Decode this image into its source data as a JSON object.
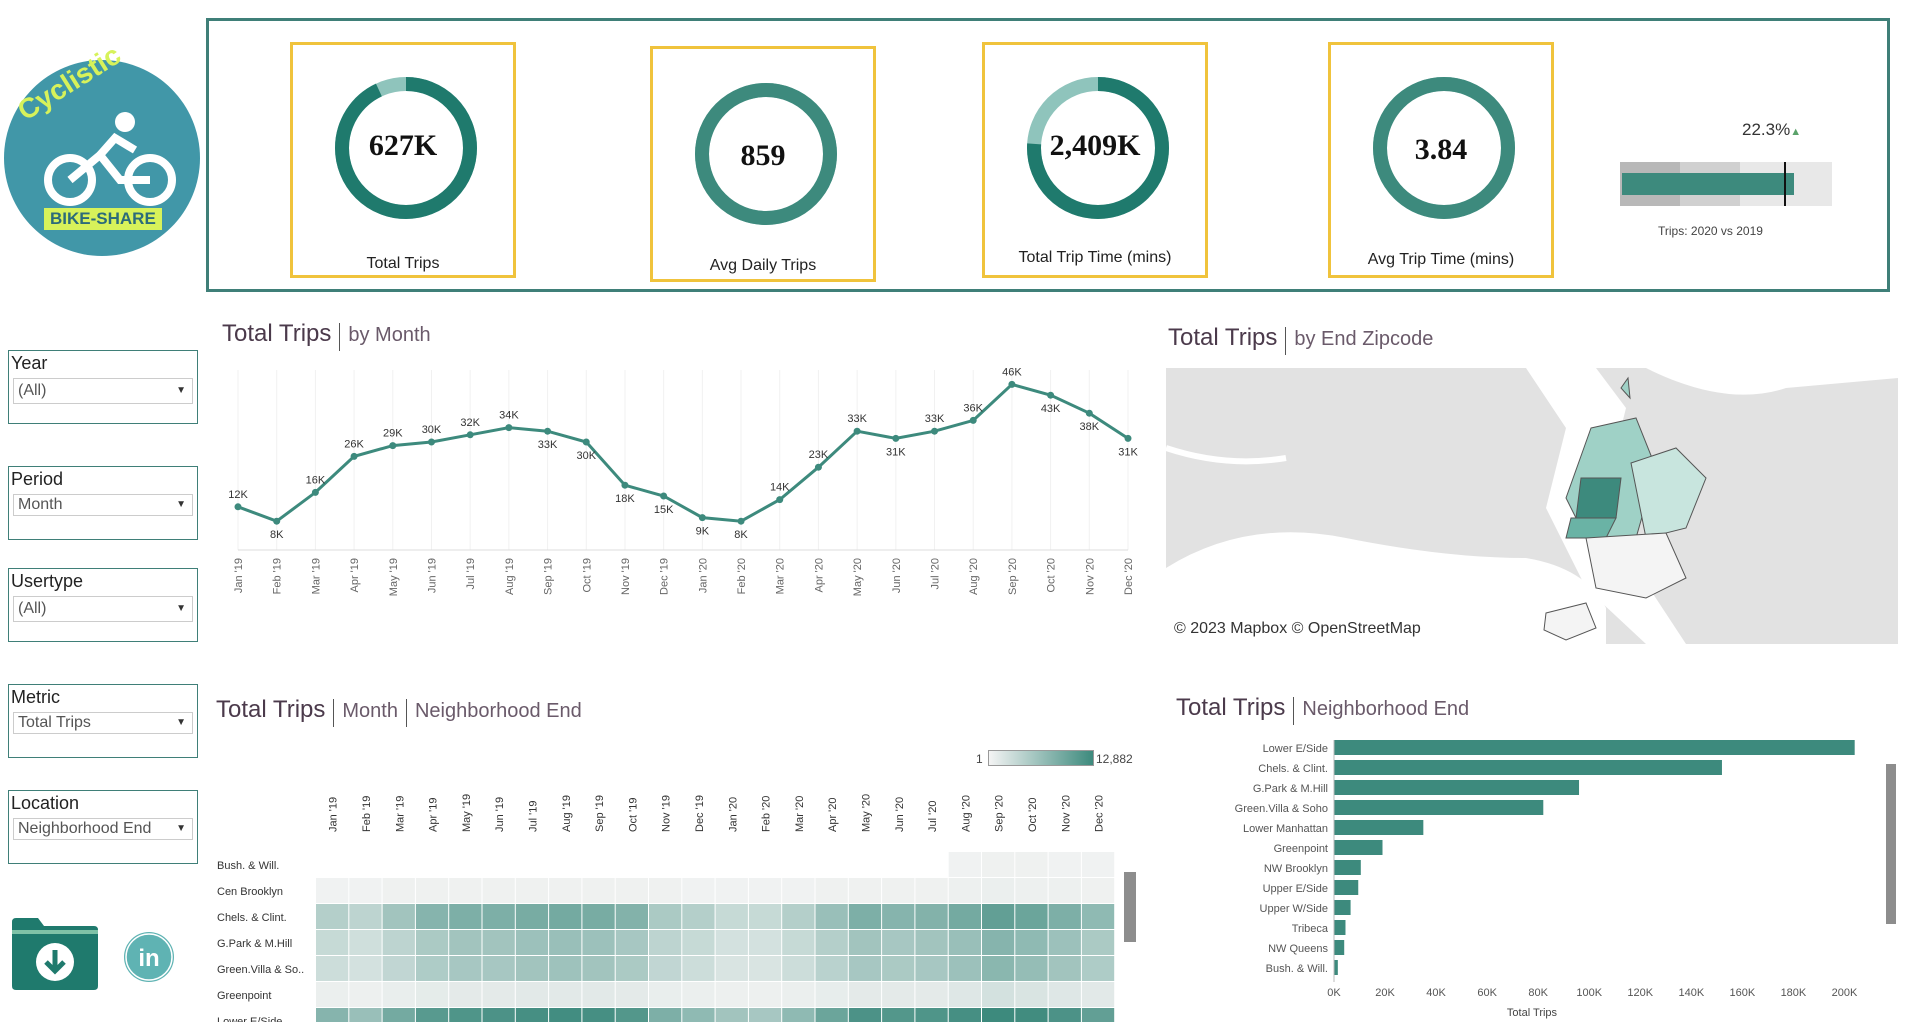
{
  "logo": {
    "word": "Cyclistic",
    "badge": "BIKE-SHARE"
  },
  "kpis": [
    {
      "value": "627K",
      "label": "Total Trips",
      "fill": 0.93
    },
    {
      "value": "859",
      "label": "Avg Daily Trips",
      "fill": 1.0
    },
    {
      "value": "2,409K",
      "label": "Total Trip  Time (mins)",
      "fill": 0.76
    },
    {
      "value": "3.84",
      "label": "Avg Trip Time (mins)",
      "fill": 1.0
    }
  ],
  "comparison": {
    "pct": "22.3%",
    "arrow": "▲",
    "label": "Trips: 2020 vs 2019",
    "fill": 0.82
  },
  "filters": [
    {
      "title": "Year",
      "value": "(All)"
    },
    {
      "title": "Period",
      "value": "Month"
    },
    {
      "title": "Usertype",
      "value": "(All)"
    },
    {
      "title": "Metric",
      "value": "Total Trips"
    },
    {
      "title": "Location",
      "value": "Neighborhood End"
    }
  ],
  "line_section": {
    "title": "Total Trips",
    "sub": "by  Month"
  },
  "map_section": {
    "title": "Total Trips",
    "sub": "by End Zipcode",
    "credit": "© 2023 Mapbox © OpenStreetMap"
  },
  "heat_section": {
    "title": "Total Trips",
    "sub1": "Month",
    "sub2": "Neighborhood End",
    "legend_min": "1",
    "legend_max": "12,882"
  },
  "bar_section": {
    "title": "Total Trips",
    "sub": "Neighborhood End",
    "axis_title": "Total Trips"
  },
  "chart_data": [
    {
      "type": "line",
      "categories": [
        "Jan '19",
        "Feb '19",
        "Mar '19",
        "Apr '19",
        "May '19",
        "Jun '19",
        "Jul '19",
        "Aug '19",
        "Sep '19",
        "Oct '19",
        "Nov '19",
        "Dec '19",
        "Jan '20",
        "Feb '20",
        "Mar '20",
        "Apr '20",
        "May '20",
        "Jun '20",
        "Jul '20",
        "Aug '20",
        "Sep '20",
        "Oct '20",
        "Nov '20",
        "Dec '20"
      ],
      "values": [
        12,
        8,
        16,
        26,
        29,
        30,
        32,
        34,
        33,
        30,
        18,
        15,
        9,
        8,
        14,
        23,
        33,
        31,
        33,
        36,
        46,
        43,
        38,
        31
      ],
      "labels": [
        "12K",
        "8K",
        "16K",
        "26K",
        "29K",
        "30K",
        "32K",
        "34K",
        "33K",
        "30K",
        "18K",
        "15K",
        "9K",
        "8K",
        "14K",
        "23K",
        "33K",
        "31K",
        "33K",
        "36K",
        "46K",
        "43K",
        "38K",
        "31K"
      ],
      "ylim": [
        0,
        50
      ]
    },
    {
      "type": "heatmap",
      "columns": [
        "Jan '19",
        "Feb '19",
        "Mar '19",
        "Apr '19",
        "May '19",
        "Jun '19",
        "Jul '19",
        "Aug '19",
        "Sep '19",
        "Oct '19",
        "Nov '19",
        "Dec '19",
        "Jan '20",
        "Feb '20",
        "Mar '20",
        "Apr '20",
        "May '20",
        "Jun '20",
        "Jul '20",
        "Aug '20",
        "Sep '20",
        "Oct '20",
        "Nov '20",
        "Dec '20"
      ],
      "rows": [
        "Bush. & Will.",
        "Cen Brooklyn",
        "Chels. & Clint.",
        "G.Park & M.Hill",
        "Green.Villa & So..",
        "Greenpoint",
        "Lower E/Side"
      ],
      "values": [
        [
          null,
          null,
          null,
          null,
          null,
          null,
          null,
          null,
          null,
          null,
          null,
          null,
          null,
          null,
          null,
          null,
          null,
          null,
          null,
          0.02,
          0.03,
          0.03,
          0.02,
          0.02
        ],
        [
          0.02,
          0.02,
          0.03,
          0.03,
          0.03,
          0.03,
          0.03,
          0.03,
          0.03,
          0.03,
          0.03,
          0.02,
          0.02,
          0.02,
          0.02,
          0.03,
          0.03,
          0.03,
          0.03,
          0.04,
          0.05,
          0.04,
          0.04,
          0.03
        ],
        [
          0.35,
          0.3,
          0.45,
          0.6,
          0.65,
          0.65,
          0.68,
          0.7,
          0.68,
          0.62,
          0.4,
          0.35,
          0.25,
          0.25,
          0.35,
          0.5,
          0.65,
          0.6,
          0.62,
          0.7,
          0.8,
          0.75,
          0.65,
          0.55
        ],
        [
          0.25,
          0.2,
          0.3,
          0.4,
          0.45,
          0.45,
          0.48,
          0.5,
          0.48,
          0.42,
          0.3,
          0.25,
          0.18,
          0.18,
          0.25,
          0.35,
          0.45,
          0.42,
          0.45,
          0.5,
          0.6,
          0.55,
          0.48,
          0.4
        ],
        [
          0.22,
          0.18,
          0.28,
          0.38,
          0.42,
          0.42,
          0.45,
          0.47,
          0.45,
          0.4,
          0.28,
          0.22,
          0.15,
          0.15,
          0.22,
          0.32,
          0.42,
          0.4,
          0.42,
          0.48,
          0.58,
          0.52,
          0.45,
          0.38
        ],
        [
          0.05,
          0.04,
          0.06,
          0.08,
          0.09,
          0.09,
          0.1,
          0.1,
          0.1,
          0.09,
          0.06,
          0.05,
          0.04,
          0.04,
          0.05,
          0.07,
          0.09,
          0.09,
          0.09,
          0.12,
          0.18,
          0.15,
          0.12,
          0.1
        ],
        [
          0.6,
          0.5,
          0.7,
          0.85,
          0.9,
          0.92,
          0.95,
          0.97,
          0.95,
          0.88,
          0.65,
          0.55,
          0.45,
          0.42,
          0.55,
          0.75,
          0.92,
          0.88,
          0.9,
          0.95,
          1.0,
          0.98,
          0.92,
          0.8
        ]
      ],
      "colorscale": [
        "#f0f0f0",
        "#3d8a7d"
      ]
    },
    {
      "type": "bar",
      "orientation": "horizontal",
      "categories": [
        "Lower E/Side",
        "Chels. & Clint.",
        "G.Park & M.Hill",
        "Green.Villa & Soho",
        "Lower Manhattan",
        "Greenpoint",
        "NW Brooklyn",
        "Upper E/Side",
        "Upper W/Side",
        "Tribeca",
        "NW Queens",
        "Bush. & Will."
      ],
      "values": [
        204000,
        152000,
        96000,
        82000,
        35000,
        19000,
        10500,
        9500,
        6500,
        4500,
        4000,
        1500
      ],
      "xticks": [
        "0K",
        "20K",
        "40K",
        "60K",
        "80K",
        "100K",
        "120K",
        "140K",
        "160K",
        "180K",
        "200K"
      ],
      "xlim": [
        0,
        210000
      ],
      "color": "#3d8a7d"
    }
  ],
  "colors": {
    "accent": "#3d8a7d",
    "card_border": "#f0c33c",
    "panel_border": "#3f7f78",
    "logo_bg": "#4197a8",
    "logo_text": "#d7f25a"
  }
}
